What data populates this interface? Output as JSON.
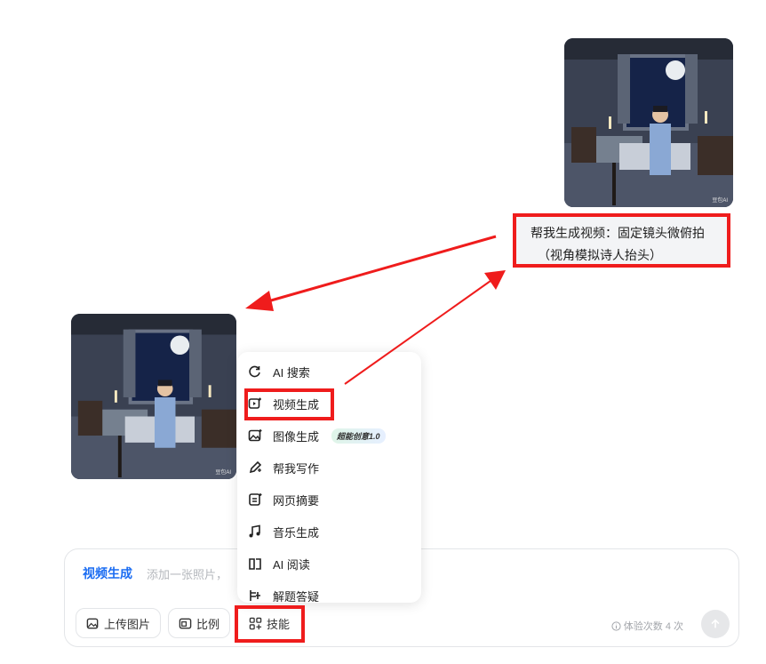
{
  "chat": {
    "user_message_line1": "帮我生成视频：固定镜头微俯拍",
    "user_message_line2": "（视角模拟诗人抬头）",
    "image_watermark": "豆包AI"
  },
  "skills_menu": {
    "items": [
      {
        "label": "AI 搜索",
        "icon": "search-icon"
      },
      {
        "label": "视频生成",
        "icon": "video-icon"
      },
      {
        "label": "图像生成",
        "icon": "image-icon",
        "badge": "超能创意1.0"
      },
      {
        "label": "帮我写作",
        "icon": "pen-icon"
      },
      {
        "label": "网页摘要",
        "icon": "webpage-icon"
      },
      {
        "label": "音乐生成",
        "icon": "music-icon"
      },
      {
        "label": "AI 阅读",
        "icon": "book-icon"
      },
      {
        "label": "解题答疑",
        "icon": "qa-icon"
      }
    ]
  },
  "input": {
    "mode_label": "视频生成",
    "placeholder": "添加一张照片，",
    "upload_button": "上传图片",
    "ratio_button": "比例",
    "skills_button": "技能",
    "quota_text": "体验次数 4 次"
  },
  "colors": {
    "accent": "#1a6cf2",
    "annotation_red": "#ef1c1c"
  }
}
